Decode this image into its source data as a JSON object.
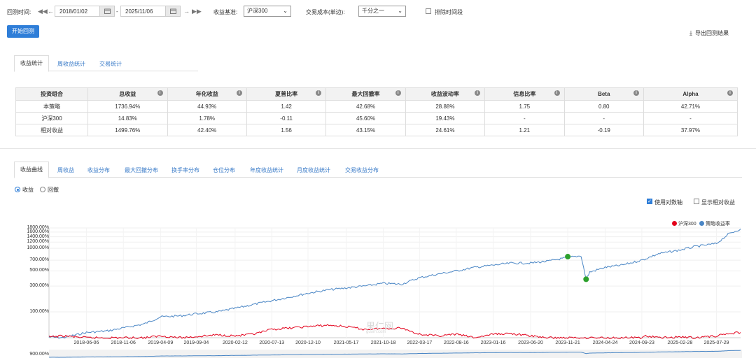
{
  "toolbar": {
    "backtest_time_label": "回测时间:",
    "start_date": "2018/01/02",
    "end_date": "2025/11/06",
    "dash": "-",
    "benchmark_label": "收益基准:",
    "benchmark_value": "沪深300",
    "cost_label": "交易成本(单边):",
    "cost_value": "千分之一",
    "exclude_label": "排除时间段",
    "start_button": "开始回测",
    "export_label": "导出回测结果"
  },
  "top_tabs": [
    "收益统计",
    "周收益统计",
    "交易统计"
  ],
  "stats_table": {
    "headers": [
      "投资组合",
      "总收益",
      "年化收益",
      "夏普比率",
      "最大回撤率",
      "收益波动率",
      "信息比率",
      "Beta",
      "Alpha"
    ],
    "rows": [
      [
        "本策略",
        "1736.94%",
        "44.93%",
        "1.42",
        "42.68%",
        "28.88%",
        "1.75",
        "0.80",
        "42.71%"
      ],
      [
        "沪深300",
        "14.83%",
        "1.78%",
        "-0.11",
        "45.60%",
        "19.43%",
        "-",
        "-",
        "-"
      ],
      [
        "相对收益",
        "1499.76%",
        "42.40%",
        "1.56",
        "43.15%",
        "24.61%",
        "1.21",
        "-0.19",
        "37.97%"
      ]
    ]
  },
  "chart_tabs": [
    "收益曲线",
    "周收益",
    "收益分布",
    "最大回撤分布",
    "换手率分布",
    "仓位分布",
    "年度收益统计",
    "月度收益统计",
    "交易收益分布"
  ],
  "radio": {
    "return_label": "收益",
    "drawdown_label": "回撤"
  },
  "options": {
    "log_axis_label": "使用对数轴",
    "relative_label": "显示相对收益"
  },
  "legend": {
    "benchmark": "沪深300",
    "strategy": "策略收益率"
  },
  "watermark": {
    "main": "果仁网",
    "sub": "guorn.com"
  },
  "colors": {
    "strategy": "#4a86c5",
    "benchmark": "#e3001b",
    "marker": "#2ca02c",
    "accent": "#2f7ed8"
  },
  "chart_data": {
    "type": "line",
    "y_scale": "log",
    "y_ticks": [
      "1800.00%",
      "1600.00%",
      "1400.00%",
      "1200.00%",
      "1000.00%",
      "700.00%",
      "500.00%",
      "300.00%",
      "100.00%"
    ],
    "x_ticks": [
      "2018-06-06",
      "2018-11-06",
      "2019-04-09",
      "2019-09-04",
      "2020-02-12",
      "2020-07-13",
      "2020-12-10",
      "2021-05-17",
      "2021-10-18",
      "2022-03-17",
      "2022-08-16",
      "2023-01-16",
      "2023-06-20",
      "2023-11-21",
      "2024-04-24",
      "2024-09-23",
      "2025-02-28",
      "2025-07-29"
    ],
    "navigator_y_tick": "900.00%",
    "series": [
      {
        "name": "策略收益率",
        "x": [
          "2018-01-02",
          "2018-03-01",
          "2018-06-06",
          "2018-09-01",
          "2018-11-06",
          "2019-02-01",
          "2019-04-09",
          "2019-07-01",
          "2019-09-04",
          "2019-12-01",
          "2020-02-12",
          "2020-05-01",
          "2020-07-13",
          "2020-10-01",
          "2020-12-10",
          "2021-03-01",
          "2021-05-17",
          "2021-08-01",
          "2021-10-18",
          "2022-01-01",
          "2022-03-17",
          "2022-06-01",
          "2022-08-16",
          "2022-11-01",
          "2023-01-16",
          "2023-04-01",
          "2023-06-20",
          "2023-09-01",
          "2023-11-21",
          "2024-01-15",
          "2024-02-05",
          "2024-02-20",
          "2024-04-24",
          "2024-07-01",
          "2024-09-23",
          "2024-12-01",
          "2025-02-28",
          "2025-05-01",
          "2025-07-29",
          "2025-09-15",
          "2025-11-06"
        ],
        "values": [
          2,
          0,
          15,
          20,
          30,
          45,
          75,
          80,
          90,
          100,
          120,
          145,
          170,
          200,
          230,
          260,
          280,
          300,
          330,
          320,
          400,
          450,
          500,
          560,
          600,
          640,
          640,
          680,
          760,
          800,
          380,
          480,
          560,
          600,
          700,
          850,
          950,
          1050,
          1150,
          1500,
          1750
        ]
      },
      {
        "name": "沪深300",
        "x": [
          "2018-01-02",
          "2018-03-01",
          "2018-06-06",
          "2018-09-01",
          "2018-11-06",
          "2019-02-01",
          "2019-04-09",
          "2019-07-01",
          "2019-09-04",
          "2019-12-01",
          "2020-02-12",
          "2020-05-01",
          "2020-07-13",
          "2020-10-01",
          "2020-12-10",
          "2021-03-01",
          "2021-05-17",
          "2021-08-01",
          "2021-10-18",
          "2022-01-01",
          "2022-03-17",
          "2022-06-01",
          "2022-08-16",
          "2022-11-01",
          "2023-01-16",
          "2023-04-01",
          "2023-06-20",
          "2023-09-01",
          "2023-11-21",
          "2024-02-01",
          "2024-04-24",
          "2024-07-01",
          "2024-09-23",
          "2024-10-08",
          "2024-12-01",
          "2025-02-28",
          "2025-05-01",
          "2025-07-29",
          "2025-09-15",
          "2025-11-06"
        ],
        "values": [
          2,
          5,
          -5,
          -15,
          -20,
          -10,
          5,
          0,
          3,
          8,
          5,
          10,
          25,
          30,
          35,
          40,
          35,
          25,
          28,
          30,
          10,
          5,
          10,
          -5,
          10,
          12,
          5,
          -5,
          -15,
          -28,
          -18,
          -20,
          -25,
          5,
          0,
          2,
          0,
          5,
          12,
          15
        ]
      }
    ],
    "markers": [
      {
        "x": "2023-11-21",
        "value": 780
      },
      {
        "x": "2024-02-05",
        "value": 380
      }
    ]
  }
}
